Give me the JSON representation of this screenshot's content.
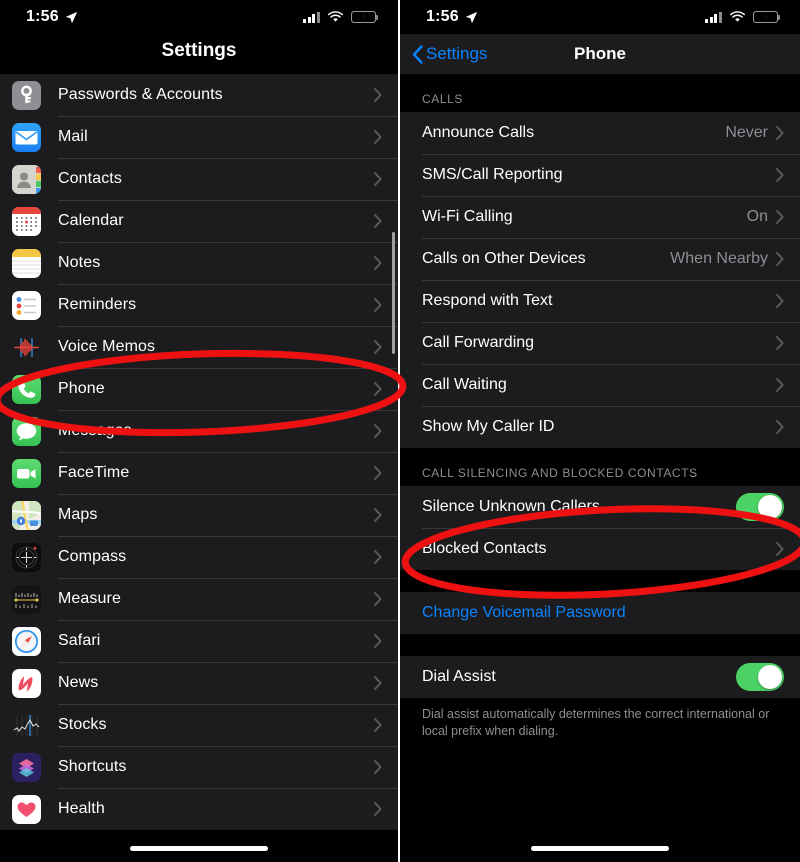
{
  "status_bar": {
    "time": "1:56",
    "location_icon": "location-arrow-icon",
    "cellular_icon": "cellular-bars-icon",
    "wifi_icon": "wifi-icon",
    "battery_icon": "battery-charging-icon",
    "battery_color": "#3ad150"
  },
  "left_screen": {
    "title": "Settings",
    "items": [
      {
        "label": "Passwords & Accounts",
        "icon": "passwords-icon"
      },
      {
        "label": "Mail",
        "icon": "mail-icon"
      },
      {
        "label": "Contacts",
        "icon": "contacts-icon"
      },
      {
        "label": "Calendar",
        "icon": "calendar-icon"
      },
      {
        "label": "Notes",
        "icon": "notes-icon"
      },
      {
        "label": "Reminders",
        "icon": "reminders-icon"
      },
      {
        "label": "Voice Memos",
        "icon": "voice-memos-icon"
      },
      {
        "label": "Phone",
        "icon": "phone-icon"
      },
      {
        "label": "Messages",
        "icon": "messages-icon"
      },
      {
        "label": "FaceTime",
        "icon": "facetime-icon"
      },
      {
        "label": "Maps",
        "icon": "maps-icon"
      },
      {
        "label": "Compass",
        "icon": "compass-icon"
      },
      {
        "label": "Measure",
        "icon": "measure-icon"
      },
      {
        "label": "Safari",
        "icon": "safari-icon"
      },
      {
        "label": "News",
        "icon": "news-icon"
      },
      {
        "label": "Stocks",
        "icon": "stocks-icon"
      },
      {
        "label": "Shortcuts",
        "icon": "shortcuts-icon"
      },
      {
        "label": "Health",
        "icon": "health-icon"
      }
    ],
    "highlight": "Phone"
  },
  "right_screen": {
    "back_label": "Settings",
    "title": "Phone",
    "sections": [
      {
        "header": "CALLS",
        "rows": [
          {
            "label": "Announce Calls",
            "value": "Never",
            "type": "disclosure"
          },
          {
            "label": "SMS/Call Reporting",
            "value": "",
            "type": "disclosure"
          },
          {
            "label": "Wi-Fi Calling",
            "value": "On",
            "type": "disclosure"
          },
          {
            "label": "Calls on Other Devices",
            "value": "When Nearby",
            "type": "disclosure"
          },
          {
            "label": "Respond with Text",
            "value": "",
            "type": "disclosure"
          },
          {
            "label": "Call Forwarding",
            "value": "",
            "type": "disclosure"
          },
          {
            "label": "Call Waiting",
            "value": "",
            "type": "disclosure"
          },
          {
            "label": "Show My Caller ID",
            "value": "",
            "type": "disclosure"
          }
        ]
      },
      {
        "header": "CALL SILENCING AND BLOCKED CONTACTS",
        "rows": [
          {
            "label": "Silence Unknown Callers",
            "value": "",
            "type": "toggle",
            "toggle_on": true
          },
          {
            "label": "Blocked Contacts",
            "value": "",
            "type": "disclosure"
          }
        ]
      },
      {
        "header": "",
        "rows": [
          {
            "label": "Change Voicemail Password",
            "value": "",
            "type": "link"
          }
        ]
      },
      {
        "header": "",
        "rows": [
          {
            "label": "Dial Assist",
            "value": "",
            "type": "toggle",
            "toggle_on": true
          }
        ],
        "footnote": "Dial assist automatically determines the correct international or local prefix when dialing."
      }
    ],
    "highlights": [
      "Silence Unknown Callers"
    ]
  },
  "annotations": {
    "color": "#ee1111",
    "shapes": [
      {
        "name": "ellipse-around-phone-row",
        "target": "Phone"
      },
      {
        "name": "ellipse-around-silence-unknown-callers",
        "target": "Silence Unknown Callers"
      }
    ]
  }
}
